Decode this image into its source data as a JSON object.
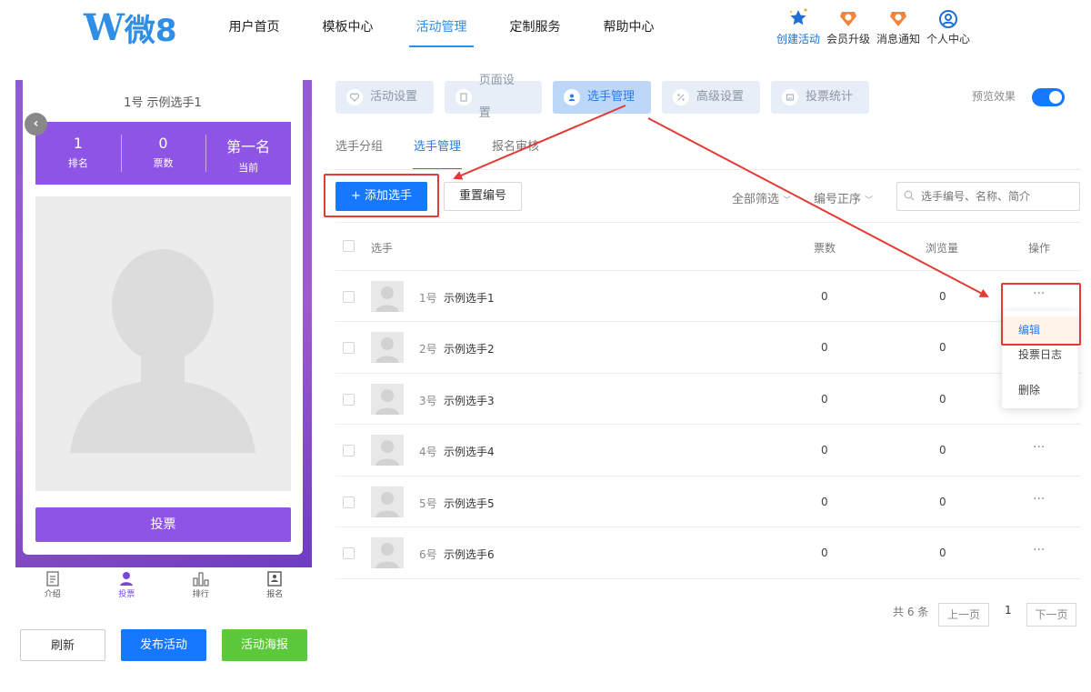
{
  "header": {
    "logo_text": "微8",
    "nav": [
      "用户首页",
      "模板中心",
      "活动管理",
      "定制服务",
      "帮助中心"
    ],
    "active_nav": "活动管理",
    "right_icons": [
      {
        "icon": "star-sparkle-icon",
        "label": "创建活动"
      },
      {
        "icon": "vip-shield-icon",
        "label": "会员升级"
      },
      {
        "icon": "bell-shield-icon",
        "label": "消息通知"
      },
      {
        "icon": "user-circle-icon",
        "label": "个人中心"
      }
    ]
  },
  "preview": {
    "title": "1号 示例选手1",
    "stats": [
      {
        "value": "1",
        "label": "排名"
      },
      {
        "value": "0",
        "label": "票数"
      },
      {
        "value": "第一名",
        "label": "当前"
      }
    ],
    "vote_button": "投票",
    "tabs": [
      {
        "icon": "doc-icon",
        "label": "介绍"
      },
      {
        "icon": "person-icon",
        "label": "投票"
      },
      {
        "icon": "bar-chart-icon",
        "label": "排行"
      },
      {
        "icon": "signup-icon",
        "label": "报名"
      }
    ],
    "buttons": {
      "refresh": "刷新",
      "publish": "发布活动",
      "poster": "活动海报"
    }
  },
  "settings_tabs": [
    {
      "icon": "heart-icon",
      "label": "活动设置"
    },
    {
      "icon": "page-icon",
      "label": "页面设置"
    },
    {
      "icon": "player-icon",
      "label": "选手管理"
    },
    {
      "icon": "percent-icon",
      "label": "高级设置"
    },
    {
      "icon": "chart-icon",
      "label": "投票统计"
    }
  ],
  "preview_toggle_label": "预览效果",
  "sub_tabs": [
    "选手分组",
    "选手管理",
    "报名审核"
  ],
  "toolbar": {
    "add_label": "+ 添加选手",
    "reset_label": "重置编号",
    "filter_all": "全部筛选",
    "sort": "编号正序",
    "search_placeholder": "选手编号、名称、简介"
  },
  "table": {
    "headers": {
      "player": "选手",
      "votes": "票数",
      "views": "浏览量",
      "actions": "操作"
    },
    "rows": [
      {
        "num": "1号",
        "name": "示例选手1",
        "votes": "0",
        "views": "0"
      },
      {
        "num": "2号",
        "name": "示例选手2",
        "votes": "0",
        "views": "0"
      },
      {
        "num": "3号",
        "name": "示例选手3",
        "votes": "0",
        "views": "0"
      },
      {
        "num": "4号",
        "name": "示例选手4",
        "votes": "0",
        "views": "0"
      },
      {
        "num": "5号",
        "name": "示例选手5",
        "votes": "0",
        "views": "0"
      },
      {
        "num": "6号",
        "name": "示例选手6",
        "votes": "0",
        "views": "0"
      }
    ],
    "more_glyph": "···"
  },
  "dropdown": {
    "items": [
      "编辑",
      "投票日志",
      "删除"
    ]
  },
  "pagination": {
    "total": "共 6 条",
    "prev": "上一页",
    "page": "1",
    "next": "下一页"
  },
  "colors": {
    "primary": "#1677ff",
    "purple": "#8d54e6",
    "green": "#5cc83b",
    "highlight": "#e53935"
  }
}
